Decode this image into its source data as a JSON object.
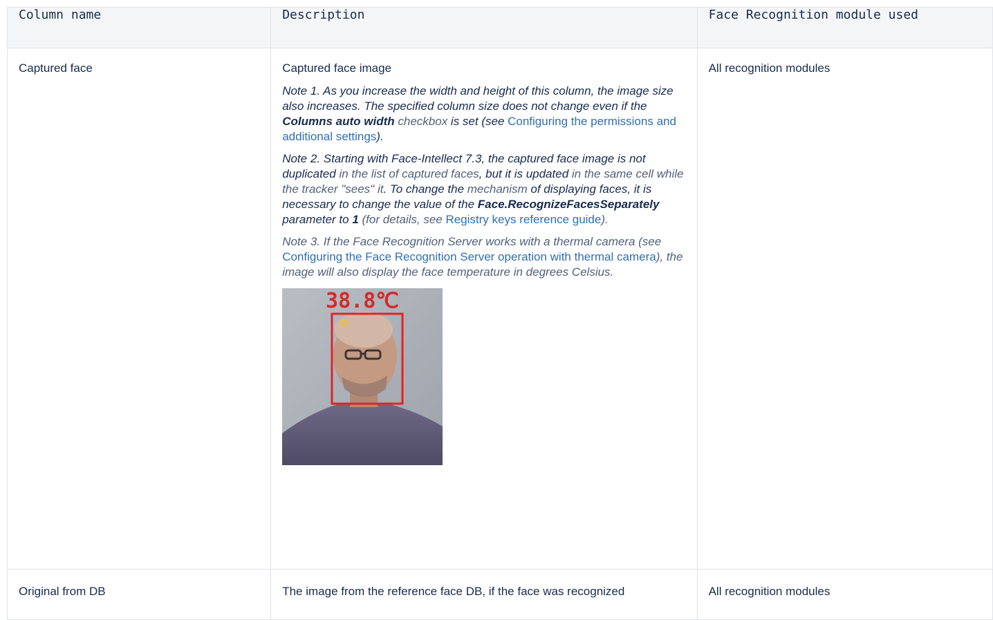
{
  "headers": [
    "Column name",
    "Description",
    "Face Recognition module used"
  ],
  "row1": {
    "name": "Captured face",
    "desc_title": "Captured face image",
    "note1": {
      "a": "Note 1. As you increase the width and height of this column, the image size also increases. The specified column size does not change even if the ",
      "bold": "Columns auto width",
      "b": " ",
      "dim": "checkbox",
      "c": " is set (see ",
      "link": "Configuring the permissions and additional settings",
      "d": ")."
    },
    "note2": {
      "a": "Note 2. Starting with Face-Intellect 7.3, the captured face image is not duplicated",
      "dim1": " in the list of captured faces",
      "b": ", but it is updated",
      "dim2": " in the same cell while the tracker \"sees\" it",
      "c": ". To change the ",
      "dim3": "mechanism",
      "d": " of displaying faces, it is necessary to change the value of the ",
      "bold1": "Face.RecognizeFacesSeparately",
      "e": " parameter to ",
      "bold2": "1",
      "dim4": " (for details, see ",
      "link": "Registry keys reference guide",
      "f": ")."
    },
    "note3": {
      "a": "Note 3. If the Face Recognition Server works with a thermal camera (see ",
      "link": "Configuring the Face Recognition Server operation with thermal camera",
      "b": "), the image will also display the face temperature in degrees Celsius."
    },
    "image_temp": "38.8℃",
    "module": "All recognition modules"
  },
  "row2": {
    "name": "Original from DB",
    "desc": "The image from the reference face DB, if the face was recognized",
    "module": "All recognition modules"
  },
  "colors": {
    "link": "#2f6eb3",
    "header_bg": "#f4f5f7",
    "border": "#dfe1e6",
    "temp_red": "#d42a2a"
  }
}
